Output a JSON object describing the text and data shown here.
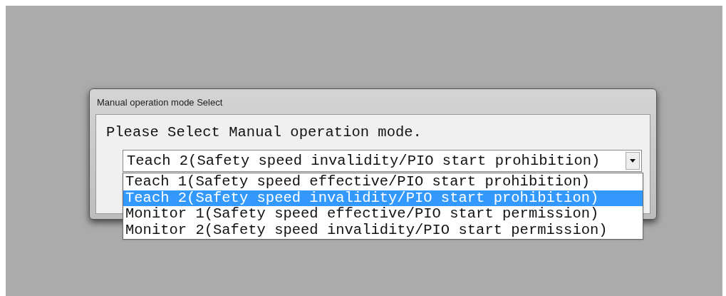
{
  "window": {
    "title": "Manual operation mode Select"
  },
  "prompt": "Please Select Manual operation mode.",
  "combo": {
    "value": "Teach 2(Safety speed invalidity/PIO start prohibition)",
    "expanded": true
  },
  "options": [
    {
      "label": "Teach 1(Safety speed effective/PIO start prohibition)",
      "selected": false
    },
    {
      "label": "Teach 2(Safety speed invalidity/PIO start prohibition)",
      "selected": true
    },
    {
      "label": "Monitor 1(Safety speed effective/PIO start permission)",
      "selected": false
    },
    {
      "label": "Monitor 2(Safety speed invalidity/PIO start permission)",
      "selected": false
    }
  ]
}
